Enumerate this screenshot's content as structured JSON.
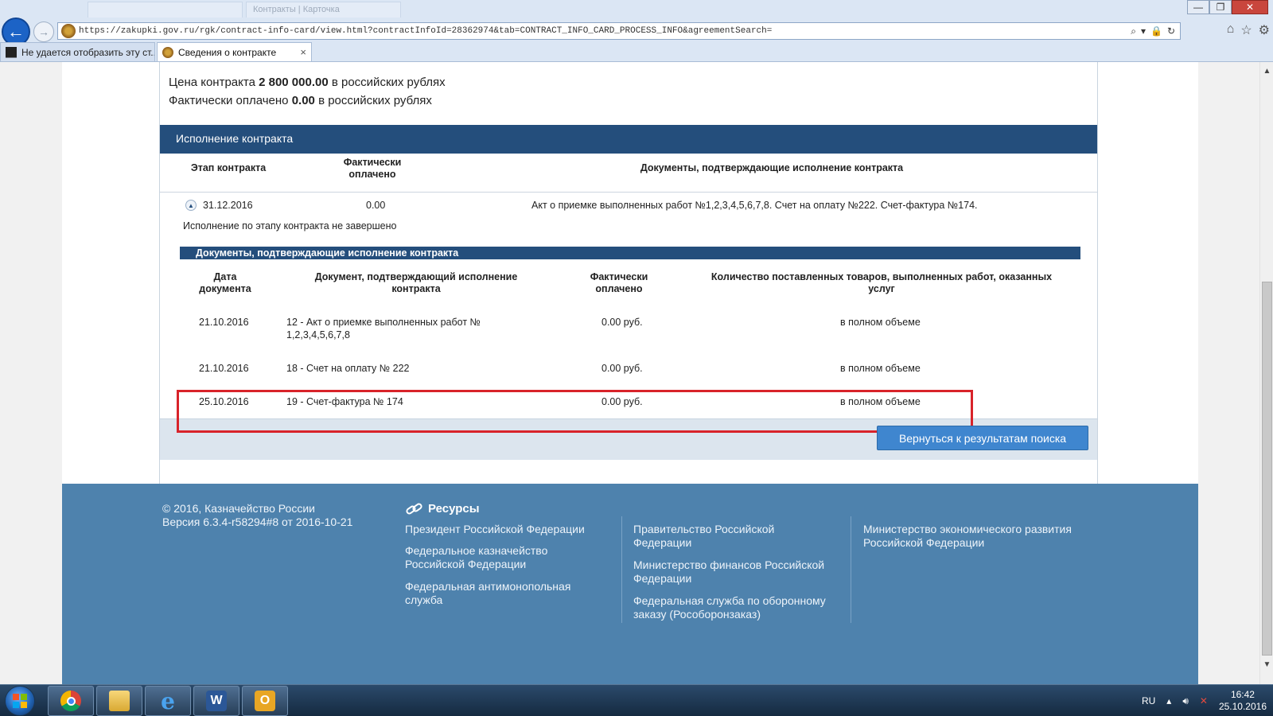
{
  "browser": {
    "ghost_tabs": [
      "",
      "Контракты | Карточка"
    ],
    "url": "https://zakupki.gov.ru/rgk/contract-info-card/view.html?contractInfoId=28362974&tab=CONTRACT_INFO_CARD_PROCESS_INFO&agreementSearch=",
    "tabs": [
      {
        "label": "Не удается отобразить эту ст...",
        "active": false
      },
      {
        "label": "Сведения о контракте",
        "active": true
      }
    ],
    "tab_close": "×",
    "window_buttons": {
      "minimize": "—",
      "maximize": "❐",
      "close": "✕"
    },
    "address_icons": {
      "search": "⌕",
      "dropdown": "▾",
      "lock": "🔒",
      "refresh": "↻"
    },
    "tool_icons": {
      "home": "⌂",
      "favorites": "☆",
      "settings": "⚙"
    }
  },
  "contract": {
    "price_label": "Цена контракта",
    "price_value": "2 800 000.00",
    "price_currency": "в российских рублях",
    "paid_label": "Фактически оплачено",
    "paid_value": "0.00",
    "paid_currency": "в российских рублях"
  },
  "execution": {
    "header": "Исполнение контракта",
    "columns": {
      "stage": "Этап контракта",
      "paid": "Фактически оплачено",
      "documents": "Документы, подтверждающие исполнение контракта"
    },
    "stage_row": {
      "date": "31.12.2016",
      "paid": "0.00",
      "documents": "Акт о приемке выполненных работ №1,2,3,4,5,6,7,8. Счет на оплату №222. Счет-фактура №174."
    },
    "status_note": "Исполнение по этапу контракта не завершено"
  },
  "documents": {
    "bar_title": "Документы, подтверждающие исполнение контракта",
    "columns": {
      "date": "Дата документа",
      "document": "Документ, подтверждающий исполнение контракта",
      "paid": "Фактически оплачено",
      "quantity": "Количество поставленных товаров, выполненных работ, оказанных услуг"
    },
    "rows": [
      {
        "date": "21.10.2016",
        "document": "12 - Акт о приемке выполненных работ № 1,2,3,4,5,6,7,8",
        "paid": "0.00 руб.",
        "quantity": "в полном объеме"
      },
      {
        "date": "21.10.2016",
        "document": "18 - Счет на оплату № 222",
        "paid": "0.00 руб.",
        "quantity": "в полном объеме"
      },
      {
        "date": "25.10.2016",
        "document": "19 - Счет-фактура № 174",
        "paid": "0.00 руб.",
        "quantity": "в полном объеме"
      }
    ]
  },
  "actions": {
    "back_to_results": "Вернуться к результатам поиска"
  },
  "footer": {
    "copyright": "© 2016, Казначейство России",
    "version": "Версия 6.3.4-r58294#8 от 2016-10-21",
    "resources_title": "Ресурсы",
    "links_col1": [
      "Президент Российской Федерации",
      "Федеральное казначейство Российской Федерации",
      "Федеральная антимонопольная служба"
    ],
    "links_col2": [
      "Правительство Российской Федерации",
      "Министерство финансов Российской Федерации",
      "Федеральная служба по оборонному заказу (Рособоронзаказ)"
    ],
    "links_col3": [
      "Министерство экономического развития Российской Федерации"
    ]
  },
  "taskbar": {
    "apps": [
      "chrome-icon",
      "file-explorer-icon",
      "internet-explorer-icon",
      "word-icon",
      "outlook-icon"
    ],
    "app_glyphs": {
      "word": "W",
      "outlook": "O",
      "ie": "e"
    },
    "language": "RU",
    "time": "16:42",
    "date": "25.10.2016"
  },
  "scrollbar_icons": {
    "up": "▲",
    "down": "▼"
  },
  "colors": {
    "header_blue": "#244e7c",
    "footer_blue": "#4e82ad",
    "button_blue": "#3f86cf",
    "highlight_red": "#d8232a"
  }
}
